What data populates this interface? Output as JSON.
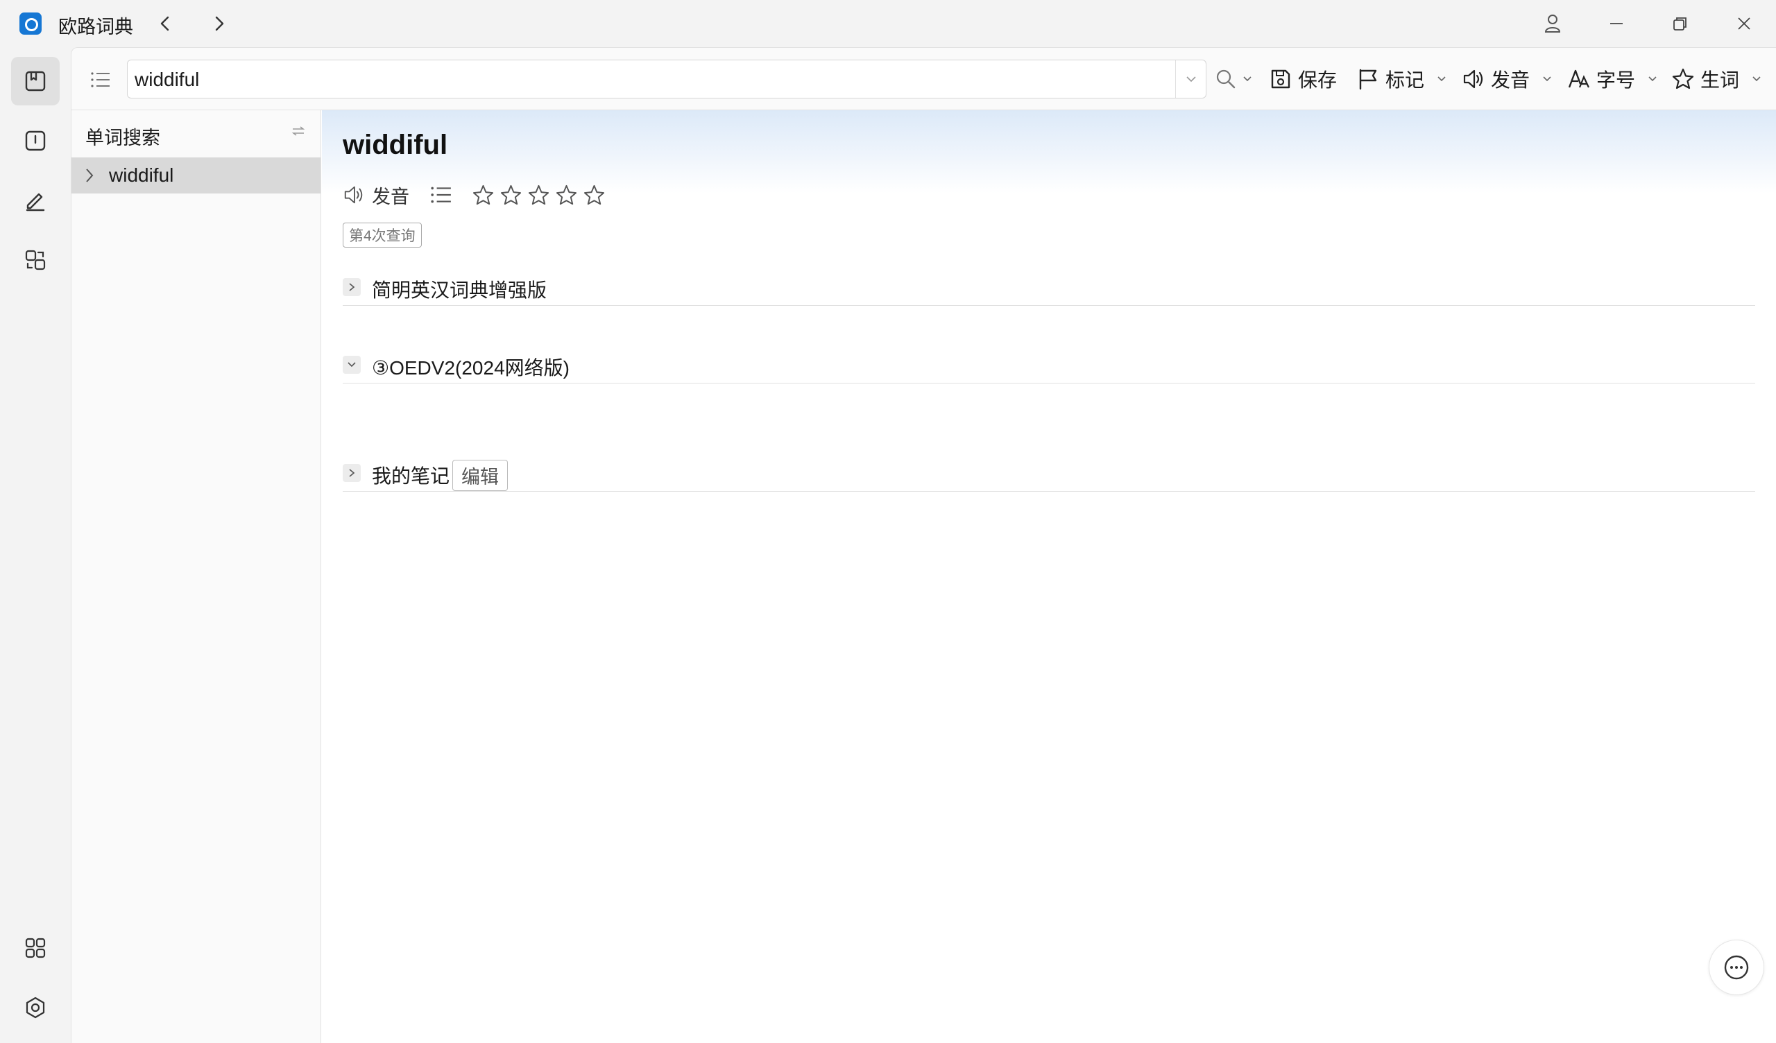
{
  "window": {
    "title": "欧路词典",
    "brand_color": "#1677d4"
  },
  "toolbar": {
    "search_value": "widdiful",
    "save_label": "保存",
    "mark_label": "标记",
    "pronounce_label": "发音",
    "font_label": "字号",
    "vocab_label": "生词"
  },
  "wordlist": {
    "header": "单词搜索",
    "items": [
      {
        "label": "widdiful",
        "selected": true
      }
    ]
  },
  "entry": {
    "headword": "widdiful",
    "pronounce_label": "发音",
    "rating_stars": 0,
    "rating_max": 5,
    "query_badge": "第4次查询",
    "sections": [
      {
        "title": "简明英汉词典增强版",
        "expanded": false
      },
      {
        "title": "③OEDV2(2024网络版)",
        "expanded": true
      },
      {
        "title": "我的笔记",
        "expanded": false,
        "edit_label": "编辑"
      }
    ]
  },
  "icons": {
    "rail": [
      "dictionary-icon",
      "reader-icon",
      "edit-pen-icon",
      "translate-icon",
      "apps-grid-icon",
      "settings-hex-icon"
    ],
    "window": [
      "user-icon",
      "minimize-icon",
      "restore-icon",
      "close-icon"
    ]
  }
}
